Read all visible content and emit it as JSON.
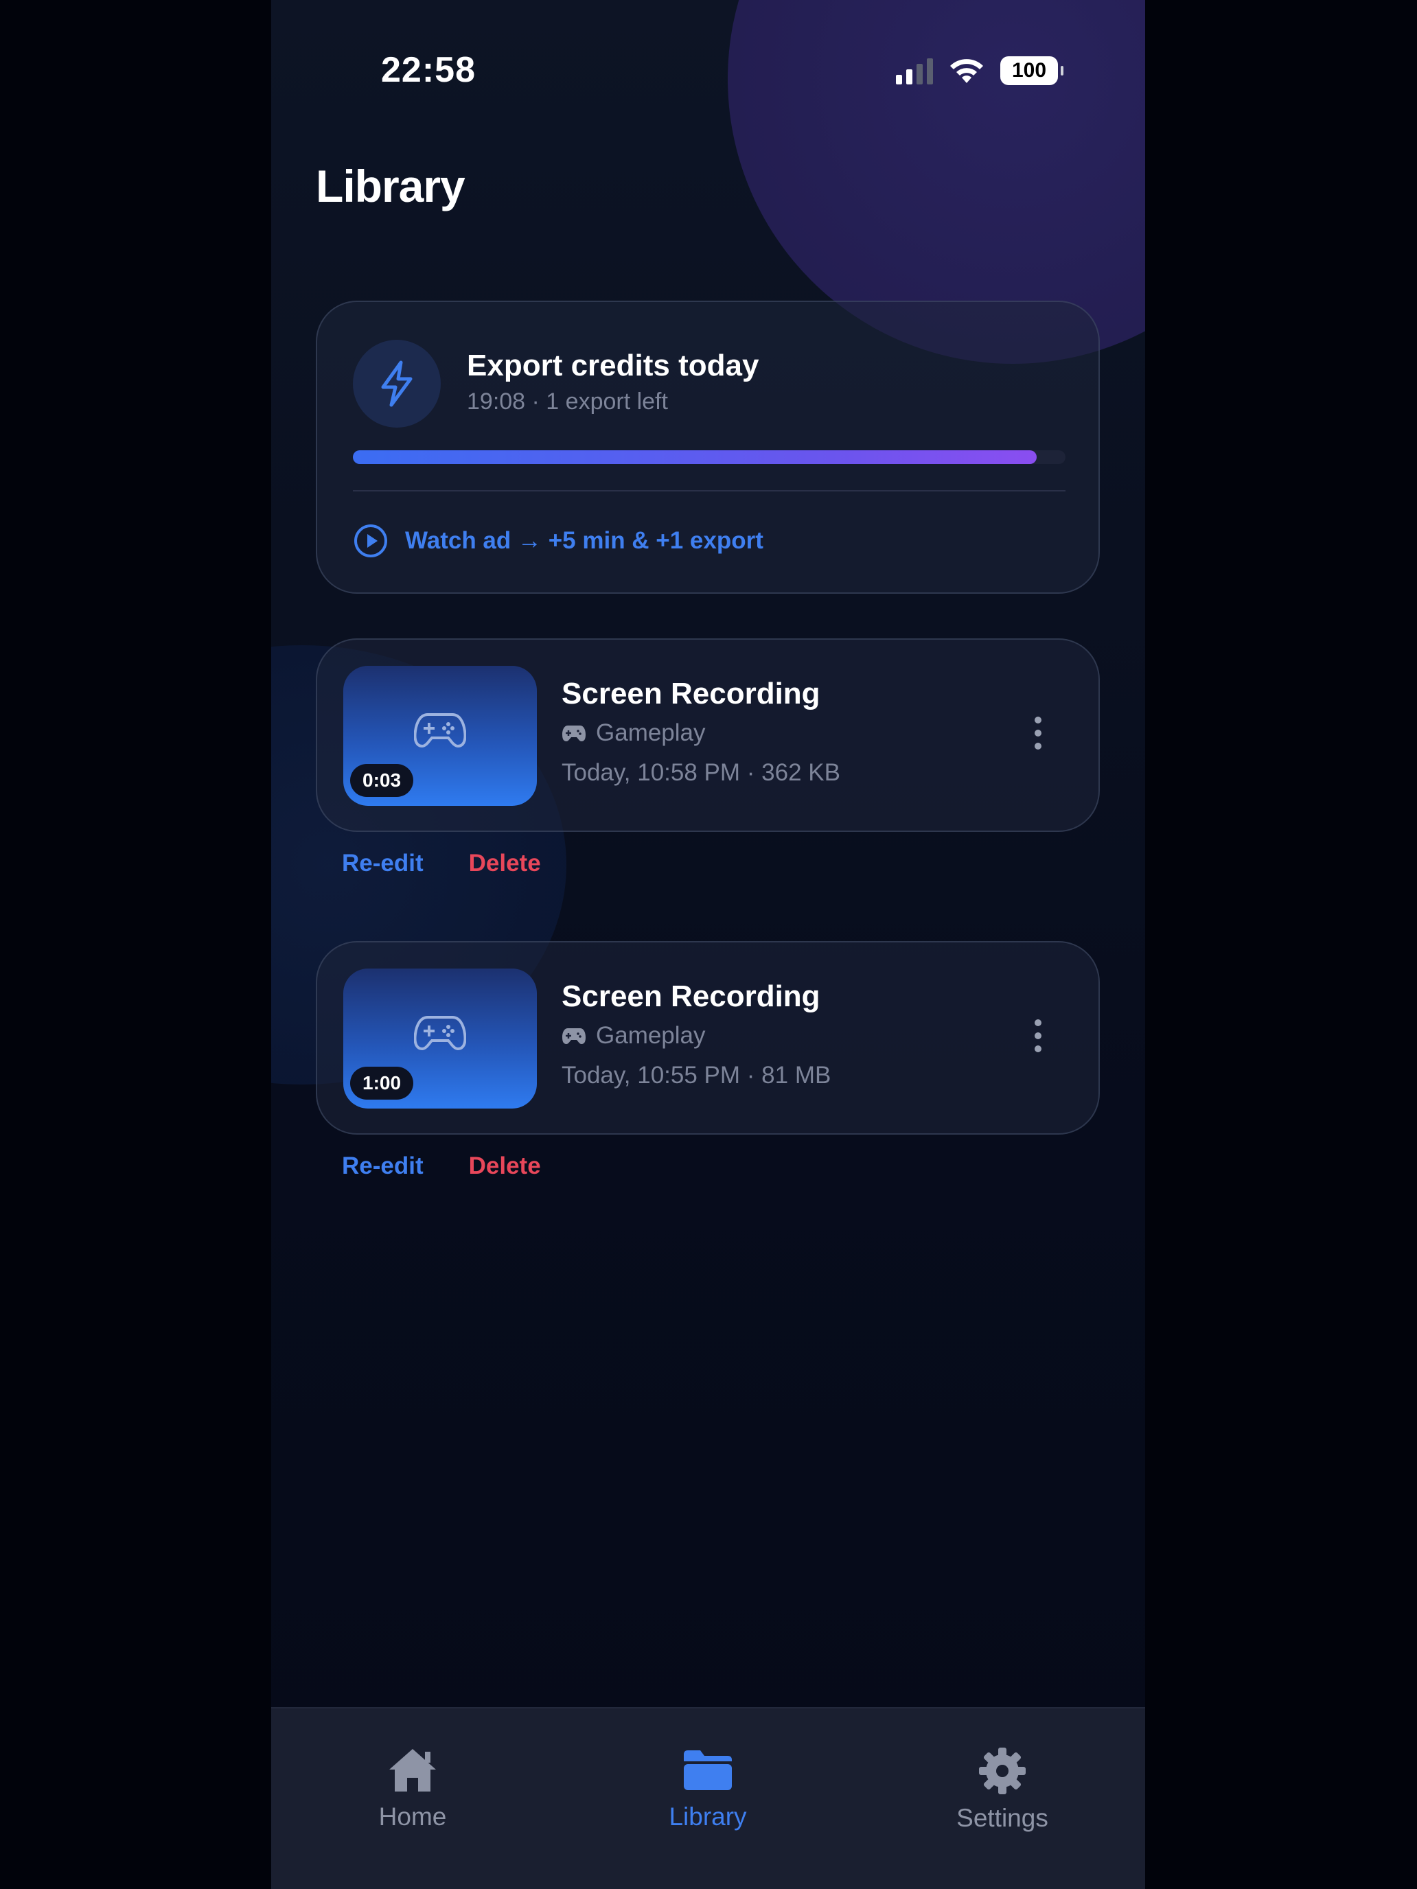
{
  "status_bar": {
    "time": "22:58",
    "battery": "100"
  },
  "page": {
    "title": "Library"
  },
  "credits": {
    "title": "Export credits today",
    "subtitle": "19:08 · 1 export left",
    "progress_fraction": 0.96,
    "watch_ad_label": "Watch ad → +5 min & +1 export",
    "icon": "bolt-icon",
    "accent": "#3f7ff0"
  },
  "recordings": [
    {
      "title": "Screen Recording",
      "category": "Gameplay",
      "meta": "Today, 10:58 PM · 362 KB",
      "duration": "0:03",
      "reedit_label": "Re-edit",
      "delete_label": "Delete"
    },
    {
      "title": "Screen Recording",
      "category": "Gameplay",
      "meta": "Today, 10:55 PM · 81 MB",
      "duration": "1:00",
      "reedit_label": "Re-edit",
      "delete_label": "Delete"
    }
  ],
  "tabs": [
    {
      "label": "Home",
      "icon": "home-icon",
      "active": false
    },
    {
      "label": "Library",
      "icon": "folder-icon",
      "active": true
    },
    {
      "label": "Settings",
      "icon": "gear-icon",
      "active": false
    }
  ],
  "colors": {
    "accent": "#3f7ff0",
    "danger": "#e8475a",
    "background": "#01030b"
  }
}
